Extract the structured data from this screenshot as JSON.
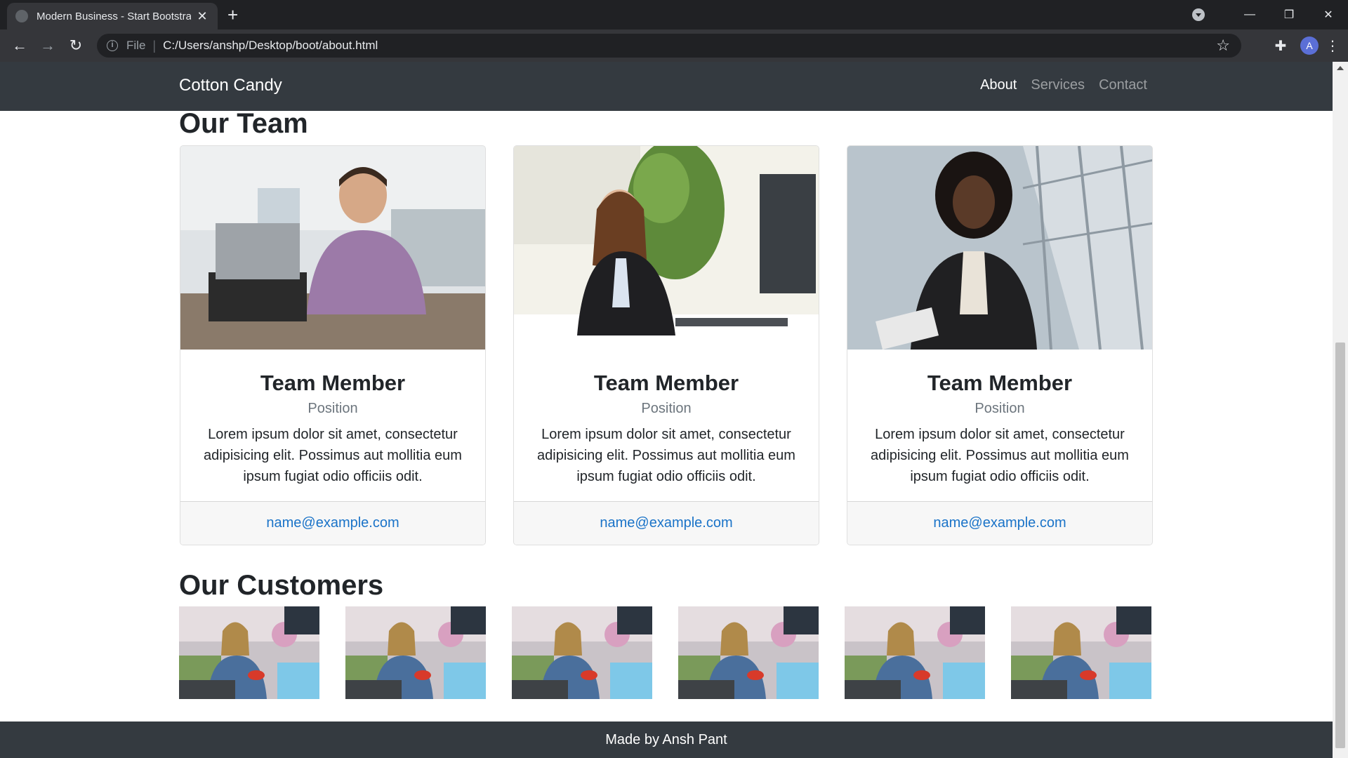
{
  "browser": {
    "tab_title": "Modern Business - Start Bootstra",
    "scheme": "File",
    "url": "C:/Users/anshp/Desktop/boot/about.html",
    "profile_initial": "A"
  },
  "site": {
    "brand": "Cotton Candy",
    "nav": [
      {
        "label": "About",
        "active": true
      },
      {
        "label": "Services",
        "active": false
      },
      {
        "label": "Contact",
        "active": false
      }
    ]
  },
  "team": {
    "heading": "Our Team",
    "members": [
      {
        "name": "Team Member",
        "position": "Position",
        "bio": "Lorem ipsum dolor sit amet, consectetur adipisicing elit. Possimus aut mollitia eum ipsum fugiat odio officiis odit.",
        "email": "name@example.com"
      },
      {
        "name": "Team Member",
        "position": "Position",
        "bio": "Lorem ipsum dolor sit amet, consectetur adipisicing elit. Possimus aut mollitia eum ipsum fugiat odio officiis odit.",
        "email": "name@example.com"
      },
      {
        "name": "Team Member",
        "position": "Position",
        "bio": "Lorem ipsum dolor sit amet, consectetur adipisicing elit. Possimus aut mollitia eum ipsum fugiat odio officiis odit.",
        "email": "name@example.com"
      }
    ]
  },
  "customers": {
    "heading": "Our Customers",
    "count": 6
  },
  "footer": {
    "text": "Made by Ansh Pant"
  },
  "colors": {
    "navbar": "#343a40",
    "link": "#1a73c8",
    "muted": "#6c757d"
  }
}
